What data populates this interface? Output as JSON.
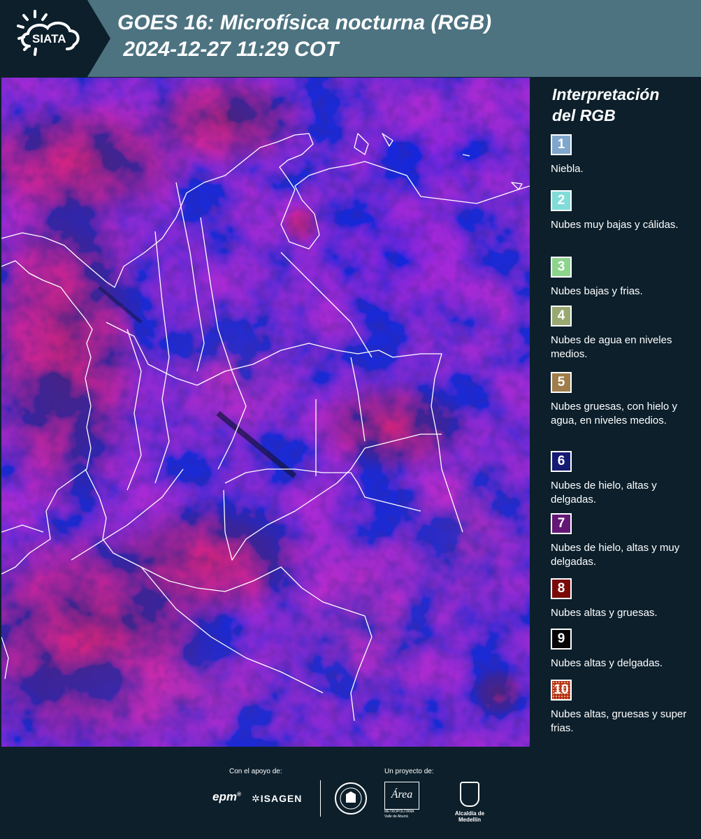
{
  "header": {
    "logo_text": "SIATA",
    "title_line1": "GOES 16: Microfísica nocturna (RGB)",
    "title_line2": " 2024-12-27 11:29 COT"
  },
  "legend": {
    "title_line1": "Interpretación",
    "title_line2": "del RGB",
    "items": [
      {
        "num": "1",
        "label": "Niebla.",
        "color": "#7fa6cc"
      },
      {
        "num": "2",
        "label": "Nubes muy bajas y cálidas.",
        "color": "#80dcd8"
      },
      {
        "num": "3",
        "label": "Nubes bajas y frias.",
        "color": "#8cd48c"
      },
      {
        "num": "4",
        "label": "Nubes de agua en niveles medios.",
        "color": "#98a870"
      },
      {
        "num": "5",
        "label": "Nubes gruesas, con hielo y agua, en niveles medios.",
        "color": "#a07d4a"
      },
      {
        "num": "6",
        "label": "Nubes de hielo, altas y delgadas.",
        "color": "#151a72"
      },
      {
        "num": "7",
        "label": "Nubes de hielo, altas y muy delgadas.",
        "color": "#651776"
      },
      {
        "num": "8",
        "label": "Nubes altas y gruesas.",
        "color": "#7a0a0a"
      },
      {
        "num": "9",
        "label": "Nubes altas y delgadas.",
        "color": "#050505"
      },
      {
        "num": "10",
        "label": "Nubes altas, gruesas y super frias.",
        "color": "#b02a14"
      }
    ]
  },
  "footer": {
    "support_label": "Con el apoyo de:",
    "project_label": "Un proyecto de:",
    "sponsor_epm": "epm",
    "sponsor_isagen": "ISAGEN",
    "partner_area_line1": "METROPOLITANA",
    "partner_area_line2": "Valle de Aburrá",
    "partner_alcaldia": "Alcaldía de Medellín"
  }
}
